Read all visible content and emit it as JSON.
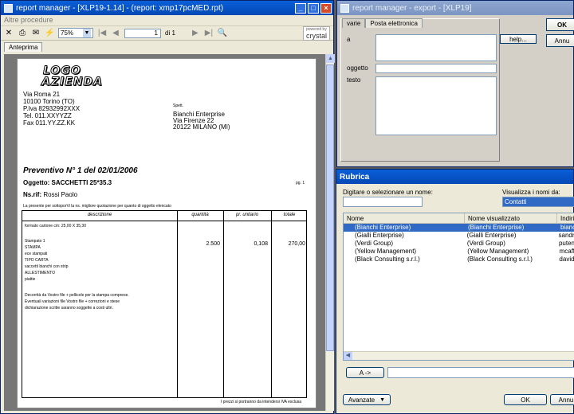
{
  "left_window": {
    "title": "report manager - [XLP19-1.14] - (report: xmp17pcMED.rpt)",
    "menu": "Altre procedure",
    "zoom": "75%",
    "page_current": "1",
    "page_of": "di 1",
    "brand_powered": "powered by",
    "brand_name": "crystal",
    "tab": "Anteprima"
  },
  "document": {
    "logo_line1": "LOGO",
    "logo_line2": "AZIENDA",
    "company": [
      "Via Roma 21",
      "10100 Torino (TO)",
      "P.Iva 82932992XXX",
      "Tel. 011.XXYYZZ",
      "Fax 011.YY.ZZ.KK"
    ],
    "spett": "Spett.",
    "client": [
      "Bianchi Enterprise",
      "Via Firenze 22",
      "20122 MILANO (MI)"
    ],
    "heading": "Preventivo N° 1 del 02/01/2006",
    "subject": "Oggetto: SACCHETTI 25*35.3",
    "page_no": "pg. 1",
    "ref_label": "Ns.rif:",
    "ref_value": "Rossi Paolo",
    "intro": "La presente per sottoporVi la ns. migliore quotazione per quanto di oggetto elencato",
    "table_headers": [
      "descrizione",
      "quantità",
      "pr. unitario",
      "totale"
    ],
    "format_line": "formato cartone cm: 25,00 X 35,30",
    "desc_lines": [
      "Stampato 1",
      "STAMPA",
      "ece stampati",
      "TIPO CARTA",
      "saccetti bianchi con strip",
      "ALLESTIMENTO",
      "piattie"
    ],
    "quantity": "2.500",
    "unit_price": "0,108",
    "total": "270,00",
    "notes": [
      "Decorrità da Vostro file + pellicole per la stampa comprese.",
      "Eventuali variazioni file Vostro file + correzioni e stese",
      "dichiarazione scritte saranno soggette a costi ultri."
    ],
    "footer": "I prezzi si portranno da intendersi IVA esclusa"
  },
  "export_window": {
    "title": "report manager - export - [XLP19]",
    "tabs": [
      "varie",
      "Posta elettronica"
    ],
    "label_a": "a",
    "help_button": "help...",
    "label_oggetto": "oggetto",
    "label_testo": "testo",
    "ok_button": "OK",
    "cancel_button": "Annu"
  },
  "rubrica": {
    "title": "Rubrica",
    "search_label": "Digitare o selezionare un nome:",
    "search_value": "",
    "view_label": "Visualizza i nomi da:",
    "view_value": "Contatti",
    "columns": [
      "Nome",
      "Nome visualizzato",
      "Indiri"
    ],
    "rows": [
      {
        "name": "(Bianchi Enterprise)",
        "display": "(Bianchi Enterprise)",
        "email": "bianc"
      },
      {
        "name": "(Gialli Enterprise)",
        "display": "(Gialli Enterprise)",
        "email": "sandra"
      },
      {
        "name": "(Verdi Group)",
        "display": "(Verdi Group)",
        "email": "putens"
      },
      {
        "name": "(Yellow Management)",
        "display": "(Yellow Management)",
        "email": "mcaffy"
      },
      {
        "name": "(Black Consulting s.r.l.)",
        "display": "(Black Consulting s.r.l.)",
        "email": "davide"
      }
    ],
    "a_button": "A    ->",
    "advanced_button": "Avanzate",
    "ok_button": "OK",
    "cancel_button": "Annu"
  }
}
